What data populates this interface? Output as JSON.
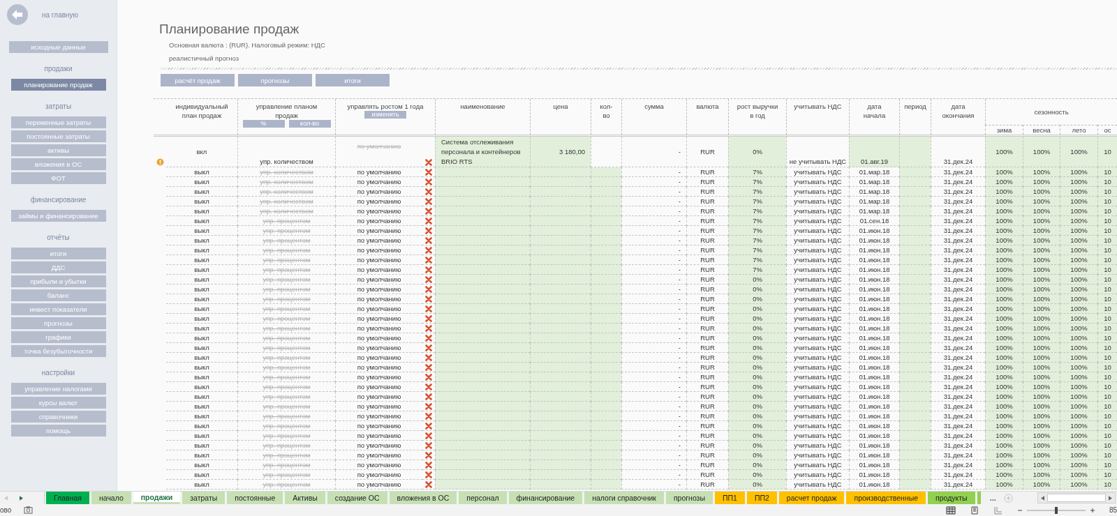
{
  "sidebar": {
    "home_link": "на главную",
    "sections": [
      {
        "items": [
          {
            "label": "исходные данные",
            "selected": false
          }
        ]
      },
      {
        "title": "продажи",
        "items": [
          {
            "label": "планирование продаж",
            "selected": true
          }
        ]
      },
      {
        "title": "затраты",
        "items": [
          {
            "label": "переменные затраты",
            "selected": false
          },
          {
            "label": "постоянные затраты",
            "selected": false
          },
          {
            "label": "активы",
            "selected": false
          },
          {
            "label": "вложения в ОС",
            "selected": false
          },
          {
            "label": "ФОТ",
            "selected": false
          }
        ]
      },
      {
        "title": "финансирование",
        "items": [
          {
            "label": "займы и финансирование",
            "selected": false
          }
        ]
      },
      {
        "title": "отчёты",
        "items": [
          {
            "label": "итоги",
            "selected": false
          },
          {
            "label": "ДДС",
            "selected": false
          },
          {
            "label": "прибыли и убытки",
            "selected": false
          },
          {
            "label": "баланс",
            "selected": false
          },
          {
            "label": "инвест показатели",
            "selected": false
          },
          {
            "label": "прогнозы",
            "selected": false
          },
          {
            "label": "графики",
            "selected": false
          },
          {
            "label": "точка безубыточности",
            "selected": false
          }
        ]
      },
      {
        "title": "настройки",
        "items": [
          {
            "label": "управление налогами",
            "selected": false
          },
          {
            "label": "курсы валют",
            "selected": false
          },
          {
            "label": "справочники",
            "selected": false
          },
          {
            "label": "помощь",
            "selected": false
          }
        ]
      }
    ]
  },
  "page": {
    "title": "Планирование продаж",
    "subtitle": "Основная валюта : (RUR). Налоговый режим: НДС",
    "scenario": "реалистичный прогноз",
    "buttons": [
      "расчёт продаж",
      "прогнозы",
      "итоги"
    ]
  },
  "table": {
    "columns": [
      {
        "label": "индивидуальный план продаж"
      },
      {
        "label": "управление планом продаж",
        "buttons": [
          "%",
          "кол-во"
        ]
      },
      {
        "label": "управлять ростом 1 года",
        "buttons": [
          "изменить"
        ]
      },
      {
        "label": "наименование"
      },
      {
        "label": "цена"
      },
      {
        "label": "кол-во"
      },
      {
        "label": "сумма"
      },
      {
        "label": "валюта"
      },
      {
        "label": "рост выручки в год"
      },
      {
        "label": "учитывать НДС"
      },
      {
        "label": "дата начала"
      },
      {
        "label": "период"
      },
      {
        "label": "дата окончания"
      }
    ],
    "season_group": {
      "label": "сезонность",
      "columns": [
        "зима",
        "весна",
        "лето",
        "ос"
      ]
    },
    "rows": [
      {
        "kind": "tall",
        "warning": true,
        "plan": "вкл",
        "mode": "упр. количеством",
        "mode_struck": false,
        "growth_mode": "по умолчанию",
        "growth_struck": true,
        "name": "Система отслеживания персонала и контейнеров BRIO RTS",
        "price": "3 180,00",
        "sum": "-",
        "currency": "RUR",
        "growth": "0%",
        "vat": "не учитывать НДС",
        "start": "01.авг.19",
        "end": "31.дек.24",
        "seasons": [
          "100%",
          "100%",
          "100%",
          "10"
        ]
      },
      {
        "kind": "normal",
        "warning": false,
        "plan": "выкл",
        "mode": "упр. количеством",
        "mode_struck": true,
        "growth_mode": "по умолчанию",
        "growth_struck": false,
        "sum": "-",
        "currency": "RUR",
        "growth": "7%",
        "vat": "учитывать НДС",
        "start": "01.мар.18",
        "end": "31.дек.24",
        "seasons": [
          "100%",
          "100%",
          "100%",
          "10"
        ]
      },
      {
        "kind": "normal",
        "warning": false,
        "plan": "выкл",
        "mode": "упр. количеством",
        "mode_struck": true,
        "growth_mode": "по умолчанию",
        "growth_struck": false,
        "sum": "-",
        "currency": "RUR",
        "growth": "7%",
        "vat": "учитывать НДС",
        "start": "01.мар.18",
        "end": "31.дек.24",
        "seasons": [
          "100%",
          "100%",
          "100%",
          "10"
        ]
      },
      {
        "kind": "normal",
        "warning": false,
        "plan": "выкл",
        "mode": "упр. количеством",
        "mode_struck": true,
        "growth_mode": "по умолчанию",
        "growth_struck": false,
        "sum": "-",
        "currency": "RUR",
        "growth": "7%",
        "vat": "учитывать НДС",
        "start": "01.мар.18",
        "end": "31.дек.24",
        "seasons": [
          "100%",
          "100%",
          "100%",
          "10"
        ]
      },
      {
        "kind": "normal",
        "warning": false,
        "plan": "выкл",
        "mode": "упр. количеством",
        "mode_struck": true,
        "growth_mode": "по умолчанию",
        "growth_struck": false,
        "sum": "-",
        "currency": "RUR",
        "growth": "7%",
        "vat": "учитывать НДС",
        "start": "01.мар.18",
        "end": "31.дек.24",
        "seasons": [
          "100%",
          "100%",
          "100%",
          "10"
        ]
      },
      {
        "kind": "normal",
        "warning": false,
        "plan": "выкл",
        "mode": "упр. количеством",
        "mode_struck": true,
        "growth_mode": "по умолчанию",
        "growth_struck": false,
        "sum": "-",
        "currency": "RUR",
        "growth": "7%",
        "vat": "учитывать НДС",
        "start": "01.мар.18",
        "end": "31.дек.24",
        "seasons": [
          "100%",
          "100%",
          "100%",
          "10"
        ]
      },
      {
        "kind": "normal",
        "warning": false,
        "plan": "выкл",
        "mode": "упр. процентом",
        "mode_struck": true,
        "growth_mode": "по умолчанию",
        "growth_struck": false,
        "sum": "-",
        "currency": "RUR",
        "growth": "7%",
        "vat": "учитывать НДС",
        "start": "01.сен.18",
        "end": "31.дек.24",
        "seasons": [
          "100%",
          "100%",
          "100%",
          "10"
        ]
      },
      {
        "kind": "normal",
        "warning": false,
        "plan": "выкл",
        "mode": "упр. процентом",
        "mode_struck": true,
        "growth_mode": "по умолчанию",
        "growth_struck": false,
        "sum": "-",
        "currency": "RUR",
        "growth": "7%",
        "vat": "учитывать НДС",
        "start": "01.июн.18",
        "end": "31.дек.24",
        "seasons": [
          "100%",
          "100%",
          "100%",
          "10"
        ]
      },
      {
        "kind": "normal",
        "warning": false,
        "plan": "выкл",
        "mode": "упр. процентом",
        "mode_struck": true,
        "growth_mode": "по умолчанию",
        "growth_struck": false,
        "sum": "-",
        "currency": "RUR",
        "growth": "7%",
        "vat": "учитывать НДС",
        "start": "01.июн.18",
        "end": "31.дек.24",
        "seasons": [
          "100%",
          "100%",
          "100%",
          "10"
        ]
      },
      {
        "kind": "normal",
        "warning": false,
        "plan": "выкл",
        "mode": "упр. процентом",
        "mode_struck": true,
        "growth_mode": "по умолчанию",
        "growth_struck": false,
        "sum": "-",
        "currency": "RUR",
        "growth": "7%",
        "vat": "учитывать НДС",
        "start": "01.июн.18",
        "end": "31.дек.24",
        "seasons": [
          "100%",
          "100%",
          "100%",
          "10"
        ]
      },
      {
        "kind": "normal",
        "warning": false,
        "plan": "выкл",
        "mode": "упр. процентом",
        "mode_struck": true,
        "growth_mode": "по умолчанию",
        "growth_struck": false,
        "sum": "-",
        "currency": "RUR",
        "growth": "7%",
        "vat": "учитывать НДС",
        "start": "01.июн.18",
        "end": "31.дек.24",
        "seasons": [
          "100%",
          "100%",
          "100%",
          "10"
        ]
      },
      {
        "kind": "normal",
        "warning": false,
        "plan": "выкл",
        "mode": "упр. процентом",
        "mode_struck": true,
        "growth_mode": "по умолчанию",
        "growth_struck": false,
        "sum": "-",
        "currency": "RUR",
        "growth": "7%",
        "vat": "учитывать НДС",
        "start": "01.июн.18",
        "end": "31.дек.24",
        "seasons": [
          "100%",
          "100%",
          "100%",
          "10"
        ]
      },
      {
        "kind": "normal",
        "warning": false,
        "plan": "выкл",
        "mode": "упр. процентом",
        "mode_struck": true,
        "growth_mode": "по умолчанию",
        "growth_struck": false,
        "sum": "-",
        "currency": "RUR",
        "growth": "0%",
        "vat": "учитывать НДС",
        "start": "01.июн.18",
        "end": "31.дек.24",
        "seasons": [
          "100%",
          "100%",
          "100%",
          "10"
        ]
      },
      {
        "kind": "normal",
        "warning": false,
        "plan": "выкл",
        "mode": "упр. процентом",
        "mode_struck": true,
        "growth_mode": "по умолчанию",
        "growth_struck": false,
        "sum": "-",
        "currency": "RUR",
        "growth": "0%",
        "vat": "учитывать НДС",
        "start": "01.июн.18",
        "end": "31.дек.24",
        "seasons": [
          "100%",
          "100%",
          "100%",
          "10"
        ]
      },
      {
        "kind": "normal",
        "warning": false,
        "plan": "выкл",
        "mode": "упр. процентом",
        "mode_struck": true,
        "growth_mode": "по умолчанию",
        "growth_struck": false,
        "sum": "-",
        "currency": "RUR",
        "growth": "0%",
        "vat": "учитывать НДС",
        "start": "01.июн.18",
        "end": "31.дек.24",
        "seasons": [
          "100%",
          "100%",
          "100%",
          "10"
        ]
      },
      {
        "kind": "normal",
        "warning": false,
        "plan": "выкл",
        "mode": "упр. процентом",
        "mode_struck": true,
        "growth_mode": "по умолчанию",
        "growth_struck": false,
        "sum": "-",
        "currency": "RUR",
        "growth": "0%",
        "vat": "учитывать НДС",
        "start": "01.июн.18",
        "end": "31.дек.24",
        "seasons": [
          "100%",
          "100%",
          "100%",
          "10"
        ]
      },
      {
        "kind": "normal",
        "warning": false,
        "plan": "выкл",
        "mode": "упр. процентом",
        "mode_struck": true,
        "growth_mode": "по умолчанию",
        "growth_struck": false,
        "sum": "-",
        "currency": "RUR",
        "growth": "0%",
        "vat": "учитывать НДС",
        "start": "01.июн.18",
        "end": "31.дек.24",
        "seasons": [
          "100%",
          "100%",
          "100%",
          "10"
        ]
      },
      {
        "kind": "normal",
        "warning": false,
        "plan": "выкл",
        "mode": "упр. процентом",
        "mode_struck": true,
        "growth_mode": "по умолчанию",
        "growth_struck": false,
        "sum": "-",
        "currency": "RUR",
        "growth": "0%",
        "vat": "учитывать НДС",
        "start": "01.июн.18",
        "end": "31.дек.24",
        "seasons": [
          "100%",
          "100%",
          "100%",
          "10"
        ]
      },
      {
        "kind": "normal",
        "warning": false,
        "plan": "выкл",
        "mode": "упр. процентом",
        "mode_struck": true,
        "growth_mode": "по умолчанию",
        "growth_struck": false,
        "sum": "-",
        "currency": "RUR",
        "growth": "0%",
        "vat": "учитывать НДС",
        "start": "01.июн.18",
        "end": "31.дек.24",
        "seasons": [
          "100%",
          "100%",
          "100%",
          "10"
        ]
      },
      {
        "kind": "normal",
        "warning": false,
        "plan": "выкл",
        "mode": "упр. процентом",
        "mode_struck": true,
        "growth_mode": "по умолчанию",
        "growth_struck": false,
        "sum": "-",
        "currency": "RUR",
        "growth": "0%",
        "vat": "учитывать НДС",
        "start": "01.июн.18",
        "end": "31.дек.24",
        "seasons": [
          "100%",
          "100%",
          "100%",
          "10"
        ]
      },
      {
        "kind": "normal",
        "warning": false,
        "plan": "выкл",
        "mode": "упр. процентом",
        "mode_struck": true,
        "growth_mode": "по умолчанию",
        "growth_struck": false,
        "sum": "-",
        "currency": "RUR",
        "growth": "0%",
        "vat": "учитывать НДС",
        "start": "01.июн.18",
        "end": "31.дек.24",
        "seasons": [
          "100%",
          "100%",
          "100%",
          "10"
        ]
      },
      {
        "kind": "normal",
        "warning": false,
        "plan": "выкл",
        "mode": "упр. процентом",
        "mode_struck": true,
        "growth_mode": "по умолчанию",
        "growth_struck": false,
        "sum": "-",
        "currency": "RUR",
        "growth": "0%",
        "vat": "учитывать НДС",
        "start": "01.июн.18",
        "end": "31.дек.24",
        "seasons": [
          "100%",
          "100%",
          "100%",
          "10"
        ]
      },
      {
        "kind": "normal",
        "warning": false,
        "plan": "выкл",
        "mode": "упр. процентом",
        "mode_struck": true,
        "growth_mode": "по умолчанию",
        "growth_struck": false,
        "sum": "-",
        "currency": "RUR",
        "growth": "0%",
        "vat": "учитывать НДС",
        "start": "01.июн.18",
        "end": "31.дек.24",
        "seasons": [
          "100%",
          "100%",
          "100%",
          "10"
        ]
      },
      {
        "kind": "normal",
        "warning": false,
        "plan": "выкл",
        "mode": "упр. процентом",
        "mode_struck": true,
        "growth_mode": "по умолчанию",
        "growth_struck": false,
        "sum": "-",
        "currency": "RUR",
        "growth": "0%",
        "vat": "учитывать НДС",
        "start": "01.июн.18",
        "end": "31.дек.24",
        "seasons": [
          "100%",
          "100%",
          "100%",
          "10"
        ]
      },
      {
        "kind": "normal",
        "warning": false,
        "plan": "выкл",
        "mode": "упр. процентом",
        "mode_struck": true,
        "growth_mode": "по умолчанию",
        "growth_struck": false,
        "sum": "-",
        "currency": "RUR",
        "growth": "0%",
        "vat": "учитывать НДС",
        "start": "01.июн.18",
        "end": "31.дек.24",
        "seasons": [
          "100%",
          "100%",
          "100%",
          "10"
        ]
      },
      {
        "kind": "normal",
        "warning": false,
        "plan": "выкл",
        "mode": "упр. процентом",
        "mode_struck": true,
        "growth_mode": "по умолчанию",
        "growth_struck": false,
        "sum": "-",
        "currency": "RUR",
        "growth": "0%",
        "vat": "учитывать НДС",
        "start": "01.июн.18",
        "end": "31.дек.24",
        "seasons": [
          "100%",
          "100%",
          "100%",
          "10"
        ]
      },
      {
        "kind": "normal",
        "warning": false,
        "plan": "выкл",
        "mode": "упр. процентом",
        "mode_struck": true,
        "growth_mode": "по умолчанию",
        "growth_struck": false,
        "sum": "-",
        "currency": "RUR",
        "growth": "0%",
        "vat": "учитывать НДС",
        "start": "01.июн.18",
        "end": "31.дек.24",
        "seasons": [
          "100%",
          "100%",
          "100%",
          "10"
        ]
      },
      {
        "kind": "normal",
        "warning": false,
        "plan": "выкл",
        "mode": "упр. процентом",
        "mode_struck": true,
        "growth_mode": "по умолчанию",
        "growth_struck": false,
        "sum": "-",
        "currency": "RUR",
        "growth": "0%",
        "vat": "учитывать НДС",
        "start": "01.июн.18",
        "end": "31.дек.24",
        "seasons": [
          "100%",
          "100%",
          "100%",
          "10"
        ]
      },
      {
        "kind": "normal",
        "warning": false,
        "plan": "выкл",
        "mode": "упр. процентом",
        "mode_struck": true,
        "growth_mode": "по умолчанию",
        "growth_struck": false,
        "sum": "-",
        "currency": "RUR",
        "growth": "0%",
        "vat": "учитывать НДС",
        "start": "01.июн.18",
        "end": "31.дек.24",
        "seasons": [
          "100%",
          "100%",
          "100%",
          "10"
        ]
      },
      {
        "kind": "normal",
        "warning": false,
        "plan": "выкл",
        "mode": "упр. процентом",
        "mode_struck": true,
        "growth_mode": "по умолчанию",
        "growth_struck": false,
        "sum": "-",
        "currency": "RUR",
        "growth": "0%",
        "vat": "учитывать НДС",
        "start": "01.июн.18",
        "end": "31.дек.24",
        "seasons": [
          "100%",
          "100%",
          "100%",
          "10"
        ]
      },
      {
        "kind": "normal",
        "warning": false,
        "plan": "выкл",
        "mode": "упр. процентом",
        "mode_struck": true,
        "growth_mode": "по умолчанию",
        "growth_struck": false,
        "sum": "-",
        "currency": "RUR",
        "growth": "0%",
        "vat": "учитывать НДС",
        "start": "01.июн.18",
        "end": "31.дек.24",
        "seasons": [
          "100%",
          "100%",
          "100%",
          "10"
        ]
      },
      {
        "kind": "normal",
        "warning": false,
        "plan": "выкл",
        "mode": "упр. процентом",
        "mode_struck": true,
        "growth_mode": "по умолчанию",
        "growth_struck": false,
        "sum": "-",
        "currency": "RUR",
        "growth": "0%",
        "vat": "учитывать НДС",
        "start": "01.июн.18",
        "end": "31.дек.24",
        "seasons": [
          "100%",
          "100%",
          "100%",
          "10"
        ]
      },
      {
        "kind": "normal",
        "warning": false,
        "plan": "выкл",
        "mode": "упр. процентом",
        "mode_struck": true,
        "growth_mode": "по умолчанию",
        "growth_struck": false,
        "sum": "-",
        "currency": "RUR",
        "growth": "0%",
        "vat": "учитывать НДС",
        "start": "01.июн.18",
        "end": "31.дек.24",
        "seasons": [
          "100%",
          "100%",
          "100%",
          "10"
        ]
      },
      {
        "kind": "normal",
        "warning": false,
        "plan": "выкл",
        "mode": "упр. процентом",
        "mode_struck": true,
        "growth_mode": "по умолчанию",
        "growth_struck": false,
        "sum": "-",
        "currency": "RUR",
        "growth": "0%",
        "vat": "учитывать НДС",
        "start": "01.июн.18",
        "end": "31.дек.24",
        "seasons": [
          "100%",
          "100%",
          "100%",
          "10"
        ]
      }
    ]
  },
  "sheet_tabs": [
    {
      "label": "Главная",
      "selected": false,
      "color": "#00b050"
    },
    {
      "label": "начало",
      "selected": false,
      "color": "#c6e0b4"
    },
    {
      "label": "продажи",
      "selected": true,
      "color": "#c6e0b4"
    },
    {
      "label": "затраты",
      "selected": false,
      "color": "#c6e0b4"
    },
    {
      "label": "постоянные",
      "selected": false,
      "color": "#c6e0b4"
    },
    {
      "label": "Активы",
      "selected": false,
      "color": "#c6e0b4"
    },
    {
      "label": "создание ОС",
      "selected": false,
      "color": "#c6e0b4"
    },
    {
      "label": "вложения в ОС",
      "selected": false,
      "color": "#c6e0b4"
    },
    {
      "label": "персонал",
      "selected": false,
      "color": "#c6e0b4"
    },
    {
      "label": "финансирование",
      "selected": false,
      "color": "#c6e0b4"
    },
    {
      "label": "налоги справочник",
      "selected": false,
      "color": "#c6e0b4"
    },
    {
      "label": "прогнозы",
      "selected": false,
      "color": "#c6e0b4"
    },
    {
      "label": "ПП1",
      "selected": false,
      "color": "#ffc000"
    },
    {
      "label": "ПП2",
      "selected": false,
      "color": "#ffc000"
    },
    {
      "label": "расчет продаж",
      "selected": false,
      "color": "#ffc000"
    },
    {
      "label": "производственные",
      "selected": false,
      "color": "#ffc000"
    },
    {
      "label": "продукты",
      "selected": false,
      "color": "#92d050"
    }
  ],
  "more_tabs": "...",
  "status_bar": {
    "status": "ово",
    "zoom_slider": {
      "level": 0.5
    },
    "zoom": "85"
  }
}
